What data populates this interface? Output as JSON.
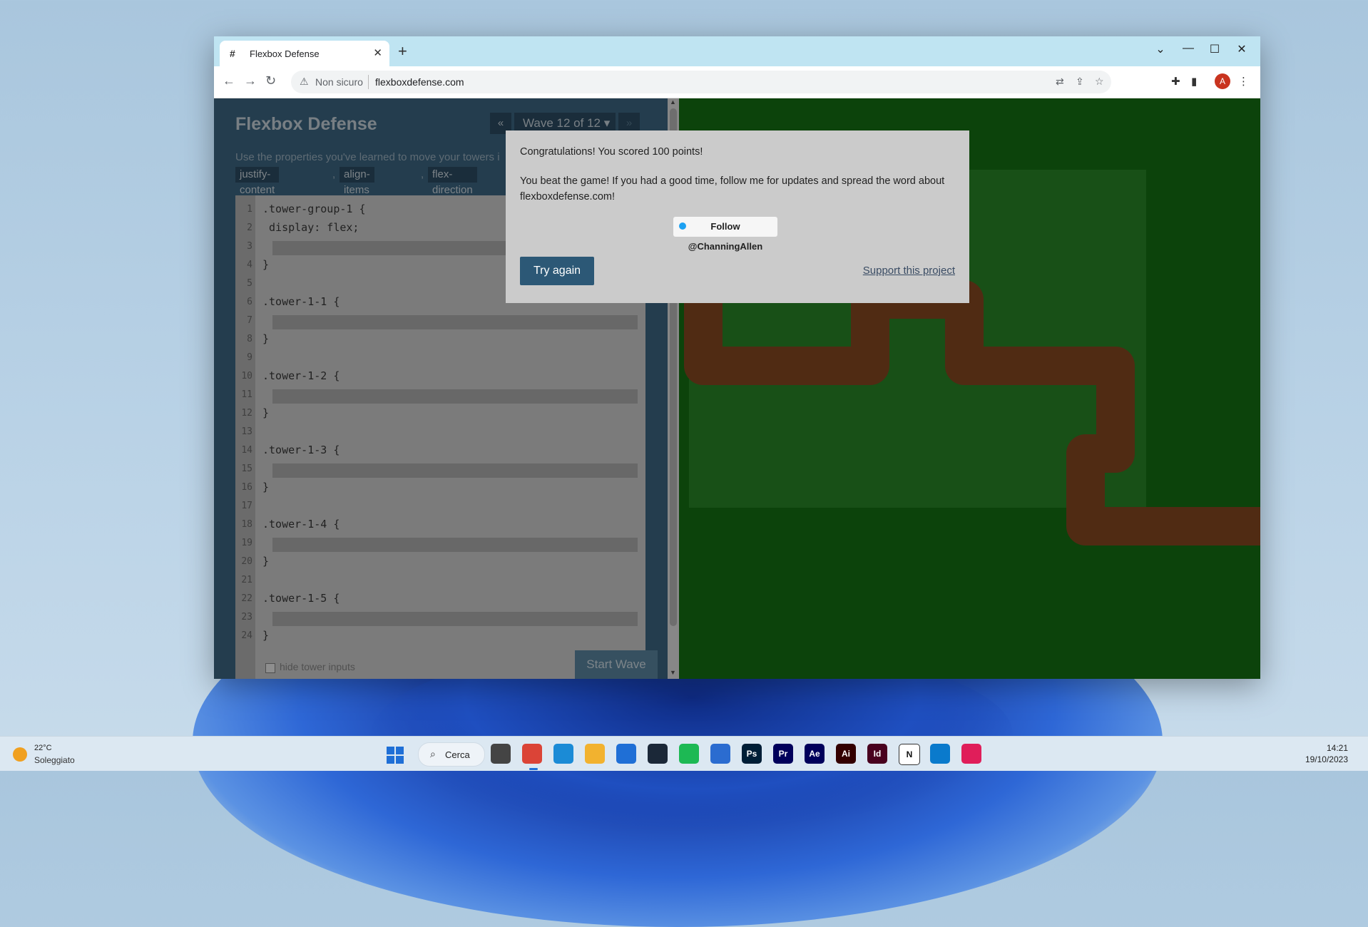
{
  "browser": {
    "tab_title": "Flexbox Defense",
    "tab_favicon": "hash-icon",
    "security_label": "Non sicuro",
    "url": "flexboxdefense.com"
  },
  "app": {
    "title": "Flexbox Defense",
    "wave_label": "Wave 12 of 12",
    "intro": "Use the properties you've learned to move your towers i",
    "chips": [
      "justify-content",
      "align-items",
      "flex-direction"
    ],
    "code_lines": [
      {
        "n": "1",
        "text": ".tower-group-1 {"
      },
      {
        "n": "2",
        "text": " display: flex;"
      },
      {
        "n": "3",
        "text": ""
      },
      {
        "n": "4",
        "text": "}"
      },
      {
        "n": "5",
        "text": ""
      },
      {
        "n": "6",
        "text": ".tower-1-1 {"
      },
      {
        "n": "7",
        "text": ""
      },
      {
        "n": "8",
        "text": "}"
      },
      {
        "n": "9",
        "text": ""
      },
      {
        "n": "10",
        "text": ".tower-1-2 {"
      },
      {
        "n": "11",
        "text": ""
      },
      {
        "n": "12",
        "text": "}"
      },
      {
        "n": "13",
        "text": ""
      },
      {
        "n": "14",
        "text": ".tower-1-3 {"
      },
      {
        "n": "15",
        "text": ""
      },
      {
        "n": "16",
        "text": "}"
      },
      {
        "n": "17",
        "text": ""
      },
      {
        "n": "18",
        "text": ".tower-1-4 {"
      },
      {
        "n": "19",
        "text": ""
      },
      {
        "n": "20",
        "text": "}"
      },
      {
        "n": "21",
        "text": ""
      },
      {
        "n": "22",
        "text": ".tower-1-5 {"
      },
      {
        "n": "23",
        "text": ""
      },
      {
        "n": "24",
        "text": "}"
      }
    ],
    "hide_inputs_label": "hide tower inputs",
    "start_wave_label": "Start Wave"
  },
  "modal": {
    "congrats": "Congratulations! You scored 100 points!",
    "body": "You beat the game! If you had a good time, follow me for updates and spread the word about flexboxdefense.com!",
    "follow_label": "Follow @ChanningAllen",
    "try_again_label": "Try again",
    "support_label": "Support this project"
  },
  "taskbar": {
    "temperature": "22°C",
    "weather": "Soleggiato",
    "search_label": "Cerca",
    "time": "14:21",
    "date": "19/10/2023",
    "apps": [
      {
        "name": "task-view-icon",
        "label": "",
        "color": "#444444"
      },
      {
        "name": "chrome-icon",
        "label": "",
        "color": "#db4437"
      },
      {
        "name": "edge-icon",
        "label": "",
        "color": "#1b8bd6"
      },
      {
        "name": "file-explorer-icon",
        "label": "",
        "color": "#f2b22f"
      },
      {
        "name": "store-icon",
        "label": "",
        "color": "#1f6fd6"
      },
      {
        "name": "steam-icon",
        "label": "",
        "color": "#1b2838"
      },
      {
        "name": "spotify-icon",
        "label": "",
        "color": "#1db954"
      },
      {
        "name": "mail-icon",
        "label": "",
        "color": "#2b6cd0"
      },
      {
        "name": "photoshop-icon",
        "label": "Ps",
        "color": "#001e36"
      },
      {
        "name": "premiere-icon",
        "label": "Pr",
        "color": "#00005b"
      },
      {
        "name": "after-effects-icon",
        "label": "Ae",
        "color": "#00005b"
      },
      {
        "name": "illustrator-icon",
        "label": "Ai",
        "color": "#330000"
      },
      {
        "name": "indesign-icon",
        "label": "Id",
        "color": "#49021f"
      },
      {
        "name": "notion-icon",
        "label": "N",
        "color": "#ffffff"
      },
      {
        "name": "vscode-icon",
        "label": "",
        "color": "#0a7acc"
      },
      {
        "name": "slack-icon",
        "label": "",
        "color": "#e01e5a"
      }
    ]
  },
  "colors": {
    "game_grass": "#157414",
    "game_path": "#8b4a22",
    "panel_bg": "#3f6a87",
    "accent": "#2c5876"
  }
}
